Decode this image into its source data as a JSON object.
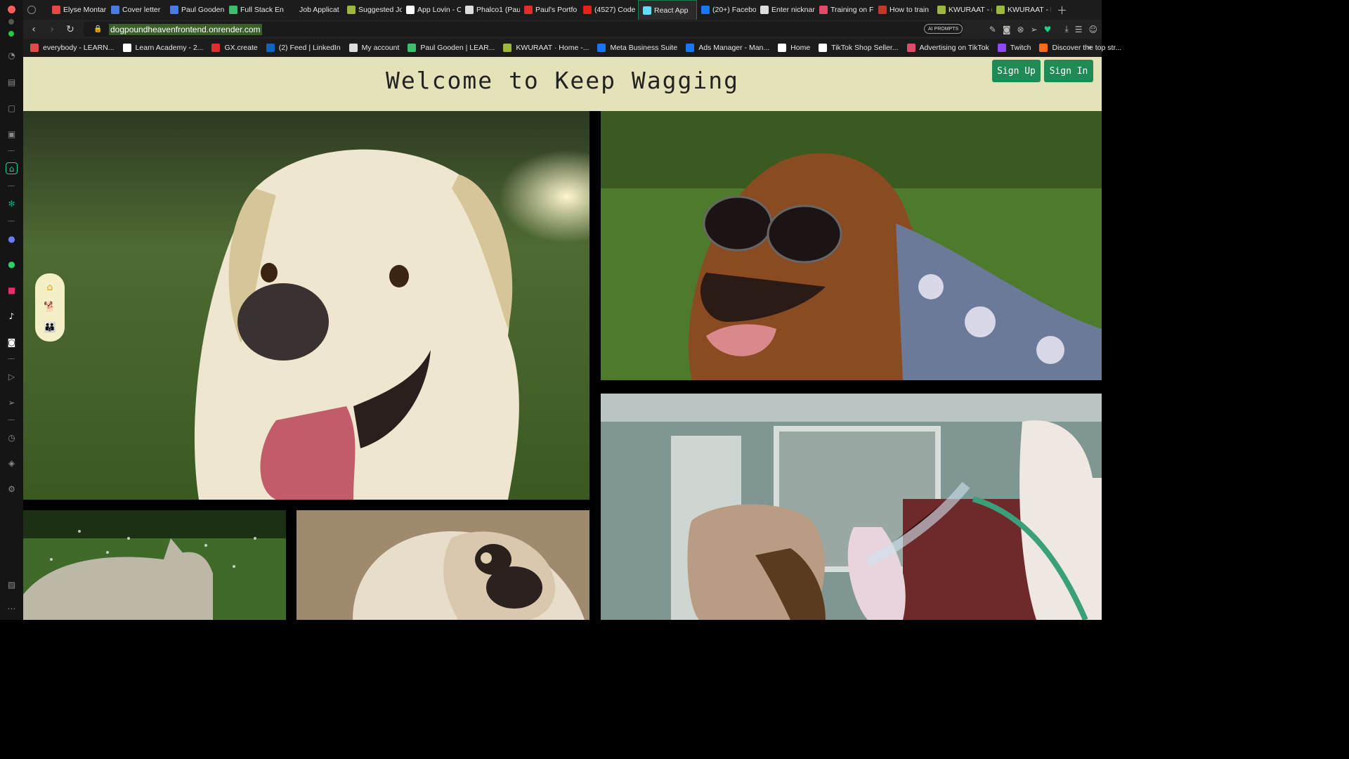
{
  "browser": {
    "tabs": [
      {
        "label": "Elyse Montar",
        "color": "#e24a4a"
      },
      {
        "label": "Cover letter",
        "color": "#4a7be2"
      },
      {
        "label": "Paul Gooden",
        "color": "#4a7be2"
      },
      {
        "label": "Full Stack En",
        "color": "#3bbf6e"
      },
      {
        "label": "Job Applicat",
        "color": "#1c1c1c"
      },
      {
        "label": "Suggested Jo",
        "color": "#9bb83c"
      },
      {
        "label": "App Lovin - C",
        "color": "#ffffff"
      },
      {
        "label": "Phalco1 (Pau",
        "color": "#dddddd"
      },
      {
        "label": "Paul's Portfo",
        "color": "#e22d2d"
      },
      {
        "label": "(4527) Code",
        "color": "#e62117"
      },
      {
        "label": "React App",
        "color": "#61dafb",
        "active": true
      },
      {
        "label": "(20+) Facebo",
        "color": "#1877f2"
      },
      {
        "label": "Enter nicknam",
        "color": "#dddddd"
      },
      {
        "label": "Training on F",
        "color": "#e24a6a"
      },
      {
        "label": "How to train",
        "color": "#c0392b"
      },
      {
        "label": "KWURAAT - (",
        "color": "#9bb83c"
      },
      {
        "label": "KWURAAT - I",
        "color": "#9bb83c"
      }
    ],
    "new_tab_icon": "plus-icon",
    "url": "dogpoundheavenfrontend.onrender.com",
    "ai_prompts_label": "AI PROMPTS",
    "bookmarks": [
      {
        "label": "everybody - LEARN...",
        "color": "#e24a4a"
      },
      {
        "label": "Learn Academy - 2...",
        "color": "#ffffff"
      },
      {
        "label": "GX.create",
        "color": "#e22d2d"
      },
      {
        "label": "(2) Feed | LinkedIn",
        "color": "#0a66c2"
      },
      {
        "label": "My account",
        "color": "#dddddd"
      },
      {
        "label": "Paul Gooden | LEAR...",
        "color": "#3bbf6e"
      },
      {
        "label": "KWURAAT · Home -...",
        "color": "#9bb83c"
      },
      {
        "label": "Meta Business Suite",
        "color": "#1877f2"
      },
      {
        "label": "Ads Manager - Man...",
        "color": "#1877f2"
      },
      {
        "label": "Home",
        "color": "#ffffff"
      },
      {
        "label": "TikTok Shop Seller...",
        "color": "#ffffff"
      },
      {
        "label": "Advertising on TikTok",
        "color": "#e24a6a"
      },
      {
        "label": "Twitch",
        "color": "#9146ff"
      },
      {
        "label": "Discover the top str...",
        "color": "#ff6b1a"
      }
    ]
  },
  "header": {
    "title": "Welcome to Keep Wagging",
    "sign_up_label": "Sign Up",
    "sign_in_label": "Sign In",
    "background": "#e3e2b8",
    "button_color": "#1f8a55"
  },
  "floating_nav": {
    "items": [
      {
        "icon": "home-icon",
        "glyph": "⌂",
        "color": "#f0a020"
      },
      {
        "icon": "dog-icon",
        "glyph": "🐕",
        "color": "#e02020"
      },
      {
        "icon": "group-icon",
        "glyph": "👪",
        "color": "#8a2be2"
      }
    ]
  }
}
